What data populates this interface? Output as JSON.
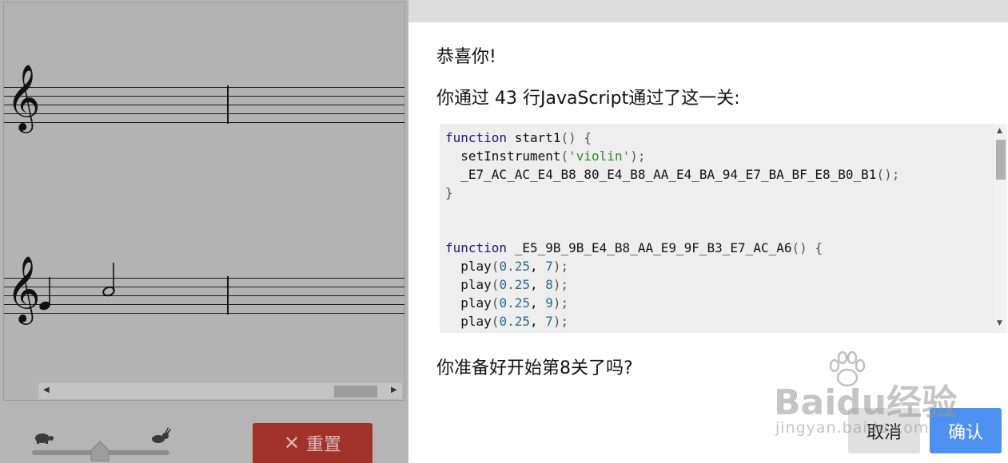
{
  "game": {
    "reset_label": "重置",
    "speed_slow_icon": "turtle-icon",
    "speed_fast_icon": "rabbit-icon",
    "speed_level": 0.5
  },
  "dialog": {
    "congrats": "恭喜你!",
    "passed_message": "你通过 43 行JavaScript通过了这一关:",
    "code_lines": [
      "function start1() {",
      "  setInstrument('violin');",
      "  _E7_AC_AC_E4_B8_80_E4_B8_AA_E4_BA_94_E7_BA_BF_E8_B0_B1();",
      "}",
      "",
      "",
      "function _E5_9B_9B_E4_B8_AA_E9_9F_B3_E7_AC_A6() {",
      "  play(0.25, 7);",
      "  play(0.25, 8);",
      "  play(0.25, 9);",
      "  play(0.25, 7);",
      "}"
    ],
    "next_question": "你准备好开始第8关了吗?",
    "cancel_label": "取消",
    "confirm_label": "确认"
  },
  "watermark": {
    "brand": "Baidu经验",
    "url": "jingyan.baidu.com"
  },
  "colors": {
    "overlay": "#b5b5b5",
    "reset_button": "#a0322a",
    "confirm_button": "#4c90f0",
    "cancel_button": "#e0e0e0",
    "code_background": "#eeeeee"
  }
}
